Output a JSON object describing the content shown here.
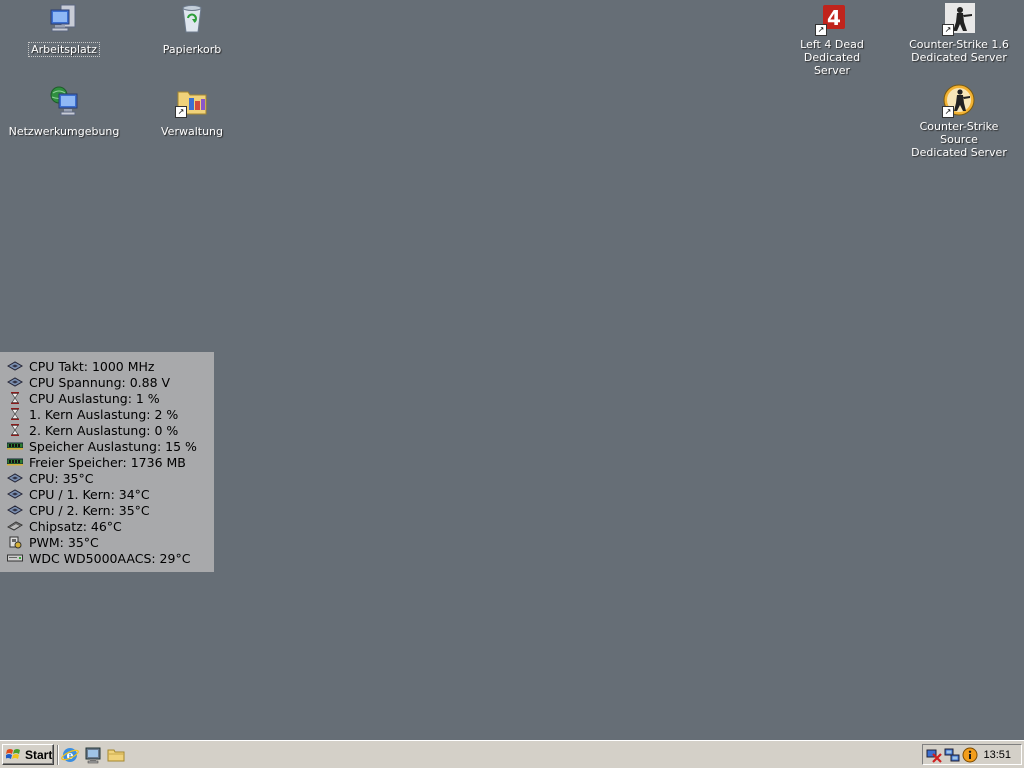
{
  "desktop": {
    "background_color": "#666e76",
    "icons_left": [
      {
        "label": "Arbeitsplatz",
        "icon": "my-computer-icon",
        "selected": true
      },
      {
        "label": "Papierkorb",
        "icon": "recycle-bin-icon"
      },
      {
        "label": "Netzwerkumgebung",
        "icon": "network-places-icon"
      },
      {
        "label": "Verwaltung",
        "icon": "administrative-tools-icon"
      }
    ],
    "icons_right": [
      {
        "label_line1": "Left 4 Dead Dedicated",
        "label_line2": "Server",
        "icon": "left4dead-icon"
      },
      {
        "label_line1": "Counter-Strike 1.6",
        "label_line2": "Dedicated Server",
        "icon": "counter-strike-icon"
      },
      {
        "label_line1": "Counter-Strike Source",
        "label_line2": "Dedicated Server",
        "icon": "counter-strike-source-icon"
      }
    ]
  },
  "sensor_panel": {
    "rows": [
      {
        "text": "CPU Takt: 1000 MHz",
        "icon": "cpu-chip-icon"
      },
      {
        "text": "CPU Spannung: 0.88 V",
        "icon": "cpu-chip-icon"
      },
      {
        "text": "CPU Auslastung: 1 %",
        "icon": "hourglass-icon"
      },
      {
        "text": "1. Kern Auslastung: 2 %",
        "icon": "hourglass-icon"
      },
      {
        "text": "2. Kern Auslastung: 0 %",
        "icon": "hourglass-icon"
      },
      {
        "text": "Speicher Auslastung: 15 %",
        "icon": "memory-module-icon"
      },
      {
        "text": "Freier Speicher: 1736 MB",
        "icon": "memory-module-icon"
      },
      {
        "text": "CPU: 35°C",
        "icon": "cpu-chip-icon"
      },
      {
        "text": "CPU / 1. Kern: 34°C",
        "icon": "cpu-chip-icon"
      },
      {
        "text": "CPU / 2. Kern: 35°C",
        "icon": "cpu-chip-icon"
      },
      {
        "text": "Chipsatz: 46°C",
        "icon": "chipset-icon"
      },
      {
        "text": "PWM: 35°C",
        "icon": "pwm-icon"
      },
      {
        "text": "WDC WD5000AACS: 29°C",
        "icon": "hard-disk-icon"
      }
    ]
  },
  "taskbar": {
    "start_label": "Start",
    "quick_launch": [
      "internet-explorer-icon",
      "show-desktop-icon",
      "explorer-folder-icon"
    ],
    "tray_icons": [
      "network-disconnected-icon",
      "network-connection-icon",
      "info-icon"
    ],
    "clock": "13:51"
  }
}
